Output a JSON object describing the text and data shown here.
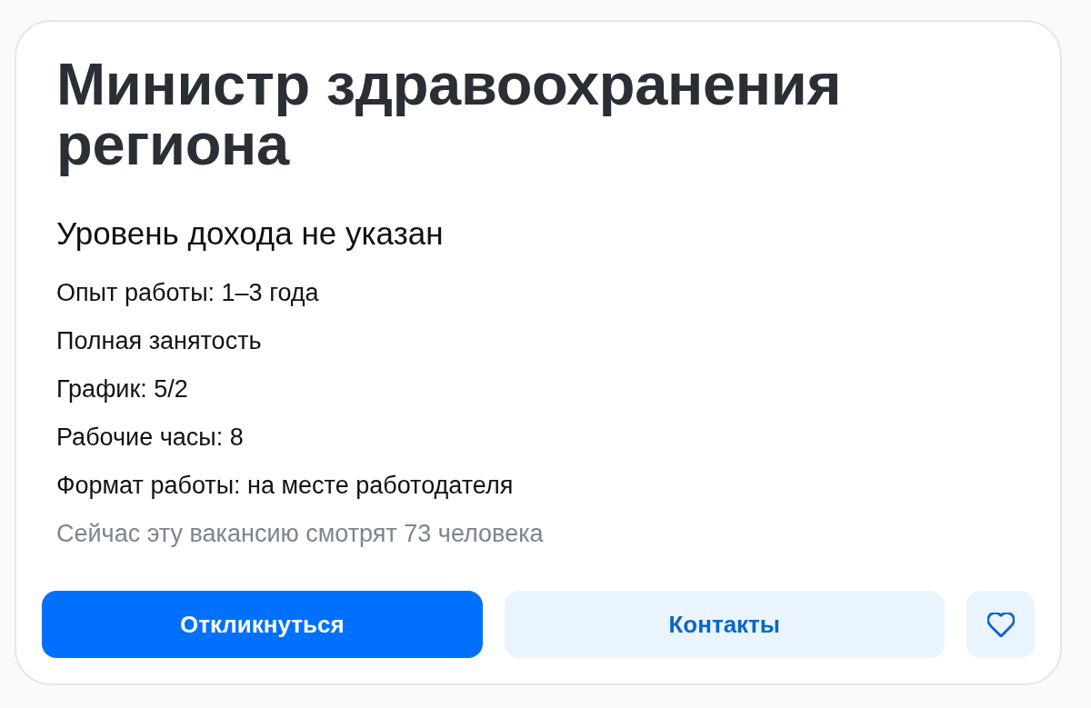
{
  "vacancy": {
    "title": "Министр здравоохранения региона",
    "salary": "Уровень дохода не указан",
    "details": [
      "Опыт работы: 1–3 года",
      "Полная занятость",
      "График: 5/2",
      "Рабочие часы: 8",
      "Формат работы: на месте работодателя"
    ],
    "views_note": "Сейчас эту вакансию смотрят 73 человека"
  },
  "actions": [
    {
      "kind": "primary",
      "label": "Откликнуться"
    },
    {
      "kind": "secondary",
      "label": "Контакты"
    },
    {
      "kind": "favorite",
      "selected": false
    }
  ]
}
